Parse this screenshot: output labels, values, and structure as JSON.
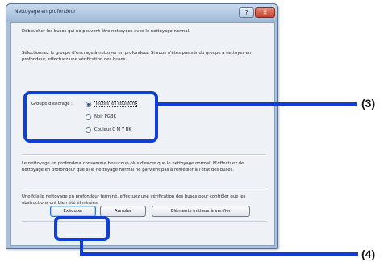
{
  "dialog": {
    "title": "Nettoyage en profondeur",
    "help_button": "?",
    "close_button": "✕",
    "intro": "Déboucher les buses qui ne peuvent être nettoyées avec le nettoyage normal.",
    "select_instruction": "Sélectionnez le groupe d'encrage à nettoyer en profondeur. Si vous n'êtes pas sûr du groupe à nettoyer en profondeur, effectuez une vérification des buses.",
    "ink_group_label": "Groupe d'encrage :",
    "options": [
      {
        "label": "Toutes les couleurs",
        "selected": true
      },
      {
        "label": "Noir  PGBK",
        "selected": false
      },
      {
        "label": "Couleur  C M Y BK",
        "selected": false
      }
    ],
    "warning": "Le nettoyage en profondeur consomme beaucoup plus d'encre que le nettoyage normal. N'effectuez de nettoyage en profondeur que si le nettoyage normal ne parvient pas à remédier à l'état des buses.",
    "after_note": "Une fois le nettoyage en profondeur terminé, effectuez une vérification des buses pour contrôler que les obstructions ont bien été éliminées.",
    "buttons": {
      "start": "Exécuter",
      "cancel": "Annuler",
      "check_items": "Eléments initiaux à vérifier"
    }
  },
  "annotations": {
    "callout_group": "(3)",
    "callout_start": "(4)",
    "color": "#0f3fd8"
  }
}
